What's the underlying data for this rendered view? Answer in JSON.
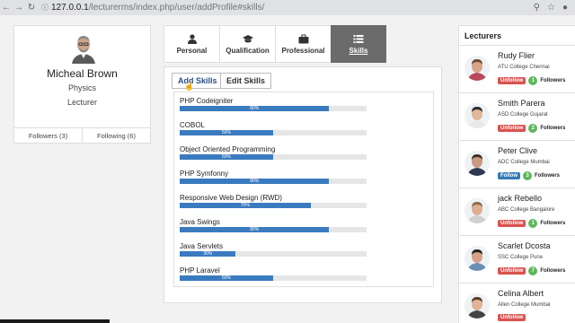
{
  "browser": {
    "host": "127.0.0.1",
    "path": "/lecturerms/index.php/user/addProfile#skills/"
  },
  "profile": {
    "name": "Micheal Brown",
    "subject": "Physics",
    "role": "Lecturer",
    "followers_label": "Followers (3)",
    "following_label": "Following (6)"
  },
  "tabs": [
    {
      "label": "Personal",
      "icon": "user-icon"
    },
    {
      "label": "Qualification",
      "icon": "graduation-cap-icon"
    },
    {
      "label": "Professional",
      "icon": "briefcase-icon"
    },
    {
      "label": "Skills",
      "icon": "list-icon",
      "active": true
    }
  ],
  "skills_panel": {
    "add_label": "Add Skills",
    "edit_label": "Edit Skills"
  },
  "skills": [
    {
      "name": "PHP Codeigniter",
      "percent": 80,
      "label": "80%"
    },
    {
      "name": "COBOL",
      "percent": 50,
      "label": "50%"
    },
    {
      "name": "Object Oriented Programming",
      "percent": 50,
      "label": "50%"
    },
    {
      "name": "PHP Symfonny",
      "percent": 80,
      "label": "80%"
    },
    {
      "name": "Responsive Web Design (RWD)",
      "percent": 70,
      "label": "70%"
    },
    {
      "name": "Java Swings",
      "percent": 80,
      "label": "80%"
    },
    {
      "name": "Java Servlets",
      "percent": 30,
      "label": "30%"
    },
    {
      "name": "PHP Laravel",
      "percent": 50,
      "label": "50%"
    }
  ],
  "lecturers_panel": {
    "title": "Lecturers",
    "items": [
      {
        "name": "Rudy Flier",
        "college": "ATU College Chennai",
        "action": "Unfollow",
        "count": "1",
        "followers": "Followers"
      },
      {
        "name": "Smith Parera",
        "college": "ASD College Gujarat",
        "action": "Unfollow",
        "count": "2",
        "followers": "Followers"
      },
      {
        "name": "Peter Clive",
        "college": "ADC College Mumbai",
        "action": "Follow",
        "count": "3",
        "followers": "Followers"
      },
      {
        "name": "jack Rebello",
        "college": "ABC College Bangalore",
        "action": "Unfollow",
        "count": "1",
        "followers": "Followers"
      },
      {
        "name": "Scarlet Dcosta",
        "college": "SSC College Pune",
        "action": "Unfollow",
        "count": "7",
        "followers": "Followers"
      },
      {
        "name": "Celina Albert",
        "college": "Allen College Mumbai",
        "action": "Unfollow",
        "count": "",
        "followers": ""
      }
    ]
  },
  "colors": {
    "accent": "#3a7bbf",
    "unfollow": "#d9534f",
    "follow": "#337ab7",
    "badge": "#5cb85c",
    "active_tab": "#6b6b6b"
  }
}
